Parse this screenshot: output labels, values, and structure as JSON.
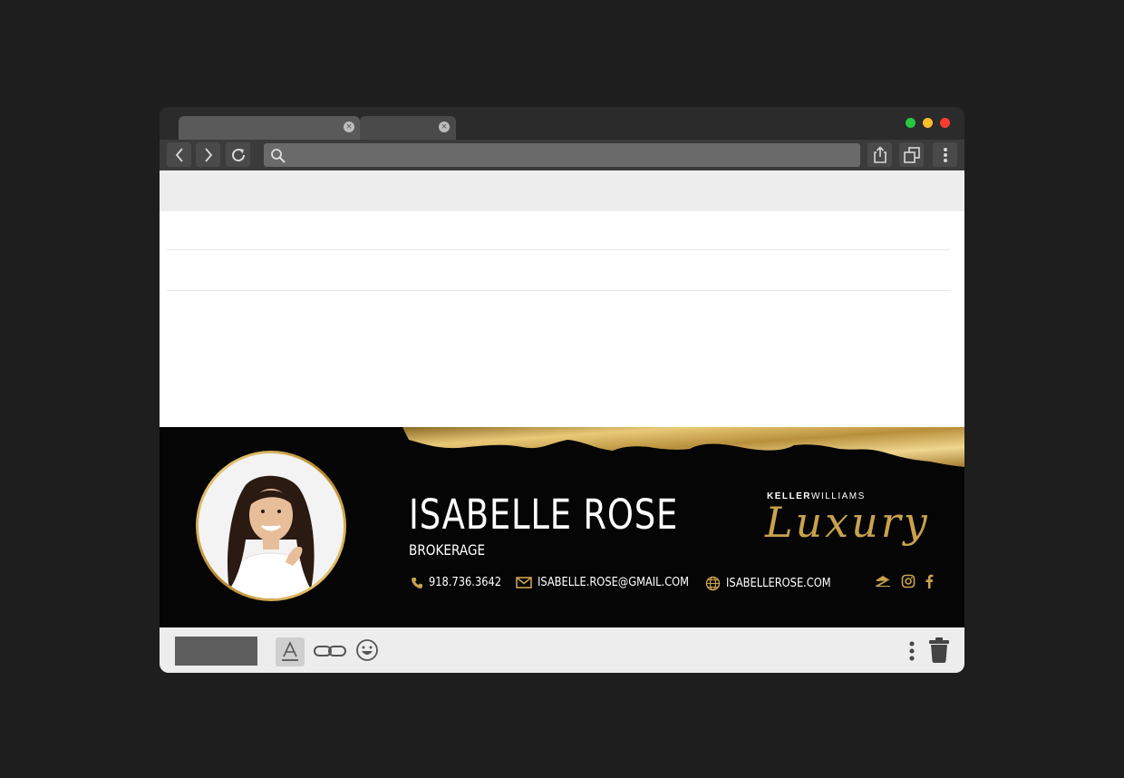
{
  "signature": {
    "name": "ISABELLE ROSE",
    "role": "BROKERAGE",
    "phone": "918.736.3642",
    "email": "ISABELLE.ROSE@GMAIL.COM",
    "website": "ISABELLEROSE.COM",
    "brand_top_bold": "KELLER",
    "brand_top_light": "WILLIAMS",
    "brand_script": "Luxury",
    "social_icons": [
      "zillow-icon",
      "instagram-icon",
      "facebook-icon"
    ],
    "accent_color": "#c9a24d"
  },
  "window": {
    "traffic_lights": [
      "#28c840",
      "#febc2e",
      "#ff3b30"
    ]
  }
}
